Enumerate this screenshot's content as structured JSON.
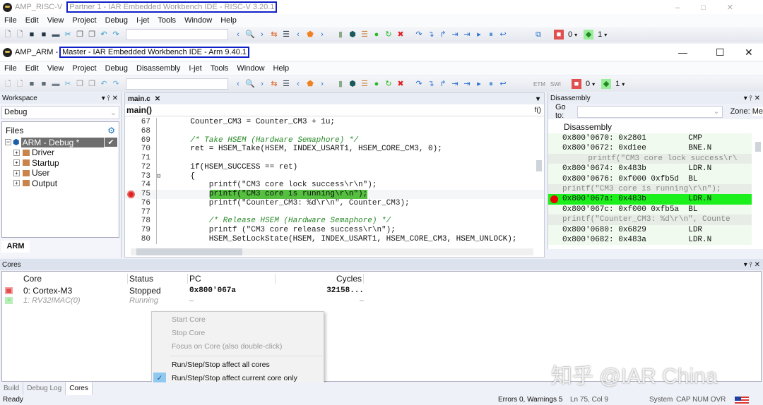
{
  "riscv_window": {
    "app": "AMP_RISC-V",
    "title": "Partner 1 - IAR Embedded Workbench IDE - RISC-V 3.20.1",
    "menu": [
      "File",
      "Edit",
      "View",
      "Project",
      "Debug",
      "I-jet",
      "Tools",
      "Window",
      "Help"
    ],
    "core0": "0",
    "core1": "1"
  },
  "arm_window": {
    "app": "AMP_ARM",
    "separator": "-",
    "title": "Master - IAR Embedded Workbench IDE - Arm 9.40.1",
    "menu": [
      "File",
      "Edit",
      "View",
      "Project",
      "Debug",
      "Disassembly",
      "I-jet",
      "Tools",
      "Window",
      "Help"
    ],
    "etm": "ETM",
    "swo": "SWI",
    "core0": "0",
    "core1": "1"
  },
  "workspace": {
    "title": "Workspace",
    "config": "Debug",
    "files_header": "Files",
    "project": "ARM - Debug *",
    "folders": [
      "Driver",
      "Startup",
      "User",
      "Output"
    ],
    "tab": "ARM"
  },
  "editor": {
    "tab": "main.c",
    "function": "main()",
    "fn_icon": "f()",
    "lines": [
      {
        "n": "67",
        "t": "    Counter_CM3 = Counter_CM3 + 1u;",
        "k": "n"
      },
      {
        "n": "68",
        "t": "",
        "k": "n"
      },
      {
        "n": "69",
        "t": "    /* Take HSEM (Hardware Semaphore) */",
        "k": "c"
      },
      {
        "n": "70",
        "t": "    ret = HSEM_Take(HSEM, INDEX_USART1, HSEM_CORE_CM3, 0);",
        "k": "n"
      },
      {
        "n": "71",
        "t": "",
        "k": "n"
      },
      {
        "n": "72",
        "t": "    if(HSEM_SUCCESS == ret)",
        "k": "n"
      },
      {
        "n": "73",
        "t": "    {",
        "k": "n"
      },
      {
        "n": "74",
        "t": "        printf(\"CM3 core lock success\\r\\n\");",
        "k": "s"
      },
      {
        "n": "75",
        "t": "        printf(\"CM3 core is running\\r\\n\");",
        "k": "cur"
      },
      {
        "n": "76",
        "t": "        printf(\"Counter_CM3: %d\\r\\n\", Counter_CM3);",
        "k": "s"
      },
      {
        "n": "77",
        "t": "",
        "k": "n"
      },
      {
        "n": "78",
        "t": "        /* Release HSEM (Hardware Semaphore) */",
        "k": "c"
      },
      {
        "n": "79",
        "t": "        printf (\"CM3 core release success\\r\\n\");",
        "k": "s"
      },
      {
        "n": "80",
        "t": "        HSEM_SetLockState(HSEM, INDEX_USART1, HSEM_CORE_CM3, HSEM_UNLOCK);",
        "k": "n"
      }
    ]
  },
  "disassembly": {
    "title": "Disassembly",
    "goto_label": "Go to:",
    "zone_label": "Zone:",
    "zone_value": "Me",
    "header": "Disassembly",
    "rows": [
      {
        "t": "0x800'0670: 0x2801         CMP",
        "k": "i"
      },
      {
        "t": "0x800'0672: 0xd1ee         BNE.N",
        "k": "i"
      },
      {
        "t": "    printf(\"CM3 core lock success\\r\\",
        "k": "s"
      },
      {
        "t": "0x800'0674: 0x483b         LDR.N",
        "k": "i"
      },
      {
        "t": "0x800'0676: 0xf000 0xfb5d  BL",
        "k": "i"
      },
      {
        "t": "printf(\"CM3 core is running\\r\\n\");",
        "k": "s"
      },
      {
        "t": "0x800'067a: 0x483b         LDR.N",
        "k": "cur"
      },
      {
        "t": "0x800'067c: 0xf000 0xfb5a  BL",
        "k": "i"
      },
      {
        "t": "printf(\"Counter_CM3: %d\\r\\n\", Counte",
        "k": "s"
      },
      {
        "t": "0x800'0680: 0x6829         LDR",
        "k": "i"
      },
      {
        "t": "0x800'0682: 0x483a         LDR.N",
        "k": "i"
      }
    ]
  },
  "cores": {
    "title": "Cores",
    "columns": [
      "Core",
      "Status",
      "PC",
      "Cycles"
    ],
    "rows": [
      {
        "core": "0: Cortex-M3",
        "status": "Stopped",
        "pc": "0x800'067a",
        "cycles": "32158..."
      },
      {
        "core": "1: RV32IMAC(0)",
        "status": "Running",
        "pc": "–",
        "cycles": "–"
      }
    ]
  },
  "context_menu": {
    "items": [
      {
        "label": "Start Core",
        "disabled": true
      },
      {
        "label": "Stop Core",
        "disabled": true
      },
      {
        "label": "Focus on Core (also double-click)",
        "disabled": true
      },
      {
        "label": "Run/Step/Stop affect all cores",
        "disabled": false
      },
      {
        "label": "Run/Step/Stop affect current core only",
        "disabled": false,
        "checked": true
      }
    ]
  },
  "bottom_tabs": [
    "Build",
    "Debug Log",
    "Cores"
  ],
  "status": {
    "ready": "Ready",
    "errors": "Errors 0, Warnings 5",
    "position": "Ln 75, Col 9",
    "system": "System",
    "keys": "CAP NUM OVR"
  },
  "watermark": "知乎 @IAR China"
}
